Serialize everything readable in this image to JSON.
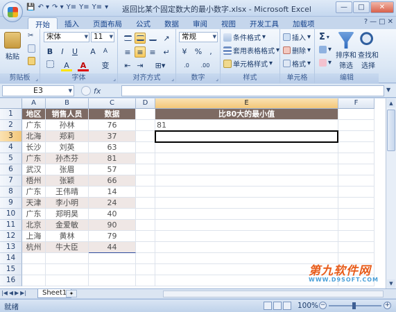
{
  "window": {
    "title": "返回比某个固定数大的最小数字.xlsx - Microsoft Excel",
    "qat_items": [
      "💾",
      "↶ ▾",
      "↷ ▾",
      "Y≡",
      "Y≡",
      "Y≡",
      "▾"
    ],
    "controls": [
      "—",
      "□",
      "✕"
    ]
  },
  "ribbon": {
    "tabs": [
      "开始",
      "插入",
      "页面布局",
      "公式",
      "数据",
      "审阅",
      "视图",
      "开发工具",
      "加载项"
    ],
    "right_icons": [
      "?",
      "—",
      "□",
      "✕"
    ],
    "clipboard": {
      "label": "剪贴板",
      "paste": "粘贴"
    },
    "font": {
      "label": "字体",
      "name": "宋体",
      "size": "11",
      "bold": "B",
      "italic": "I",
      "underline": "U",
      "grow": "A",
      "shrink": "A",
      "fill_letter": "A",
      "font_color_letter": "A",
      "wen": "变"
    },
    "alignment": {
      "label": "对齐方式"
    },
    "number": {
      "label": "数字",
      "format": "常规",
      "percent": "%",
      "comma": ",",
      "dec_inc": ".0",
      "dec_dec": ".00"
    },
    "styles": {
      "label": "样式",
      "items": [
        "条件格式",
        "套用表格格式",
        "单元格样式"
      ]
    },
    "cells": {
      "label": "单元格",
      "items": [
        "插入",
        "删除",
        "格式"
      ]
    },
    "editing": {
      "label": "编辑",
      "sigma": "Σ",
      "sort": "排序和",
      "sort2": "筛选",
      "find": "查找和",
      "find2": "选择"
    }
  },
  "formula_bar": {
    "name_box": "E3",
    "fx": "fx",
    "formula": ""
  },
  "sheet": {
    "columns": [
      "A",
      "B",
      "C",
      "D",
      "E",
      "F"
    ],
    "rows": [
      "1",
      "2",
      "3",
      "4",
      "5",
      "6",
      "7",
      "8",
      "9",
      "10",
      "11",
      "12",
      "13",
      "14",
      "15",
      "16"
    ],
    "headers": [
      "地区",
      "销售人员",
      "数据"
    ],
    "data": [
      [
        "广东",
        "孙林",
        "76"
      ],
      [
        "北海",
        "郑莉",
        "37"
      ],
      [
        "长沙",
        "刘英",
        "63"
      ],
      [
        "广东",
        "孙杰芬",
        "81"
      ],
      [
        "武汉",
        "张眉",
        "57"
      ],
      [
        "梧州",
        "张颖",
        "66"
      ],
      [
        "广东",
        "王伟晴",
        "14"
      ],
      [
        "天津",
        "李小明",
        "24"
      ],
      [
        "广东",
        "郑明昊",
        "40"
      ],
      [
        "北京",
        "金爱敏",
        "90"
      ],
      [
        "上海",
        "黄林",
        "79"
      ],
      [
        "杭州",
        "牛大臣",
        "44"
      ]
    ],
    "e_header": "比80大的最小值",
    "e2": "81",
    "active_cell": "E3"
  },
  "sheet_tabs": {
    "active": "Sheet1"
  },
  "status": {
    "mode": "就绪",
    "zoom": "100%"
  },
  "watermark": {
    "big": "第九软件网",
    "small": "WWW.D9SOFT.COM"
  }
}
